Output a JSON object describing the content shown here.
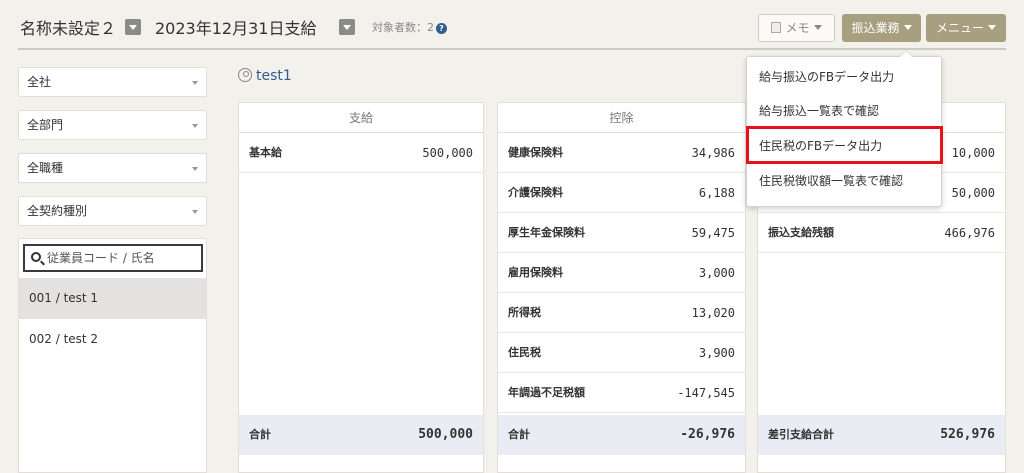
{
  "header": {
    "name": "名称未設定２",
    "payday": "2023年12月31日支給",
    "count_label": "対象者数：2",
    "memo_label": "メモ",
    "transfer_label": "振込業務",
    "menu_label": "メニュー"
  },
  "filters": {
    "company": "全社",
    "department": "全部門",
    "job_type": "全職種",
    "contract_type": "全契約種別"
  },
  "search": {
    "placeholder": "従業員コード / 氏名"
  },
  "employees": [
    {
      "label": "001 / test 1"
    },
    {
      "label": "002 / test 2"
    }
  ],
  "employee_name": "test1",
  "payments": {
    "title": "支給",
    "rows": [
      {
        "label": "基本給",
        "value": "500,000"
      }
    ],
    "total_label": "合計",
    "total_value": "500,000"
  },
  "deductions": {
    "title": "控除",
    "rows": [
      {
        "label": "健康保険料",
        "value": "34,986"
      },
      {
        "label": "介護保険料",
        "value": "6,188"
      },
      {
        "label": "厚生年金保険料",
        "value": "59,475"
      },
      {
        "label": "雇用保険料",
        "value": "3,000"
      },
      {
        "label": "所得税",
        "value": "13,020"
      },
      {
        "label": "住民税",
        "value": "3,900"
      },
      {
        "label": "年調過不足税額",
        "value": "-147,545"
      }
    ],
    "total_label": "合計",
    "total_value": "-26,976"
  },
  "summary": {
    "rows": [
      {
        "label": "",
        "value": "10,000"
      },
      {
        "label": "",
        "value": "50,000"
      },
      {
        "label": "振込支給残額",
        "value": "466,976"
      }
    ],
    "total_label": "差引支給合計",
    "total_value": "526,976"
  },
  "dropdown": {
    "items": [
      {
        "label": "給与振込のFBデータ出力"
      },
      {
        "label": "給与振込一覧表で確認"
      },
      {
        "label": "住民税のFBデータ出力"
      },
      {
        "label": "住民税徴収額一覧表で確認"
      }
    ]
  },
  "colors": {
    "accent": "#a89e80",
    "link": "#2f5c8f",
    "highlight": "#e8101a",
    "total_bg": "#e9edf3"
  }
}
